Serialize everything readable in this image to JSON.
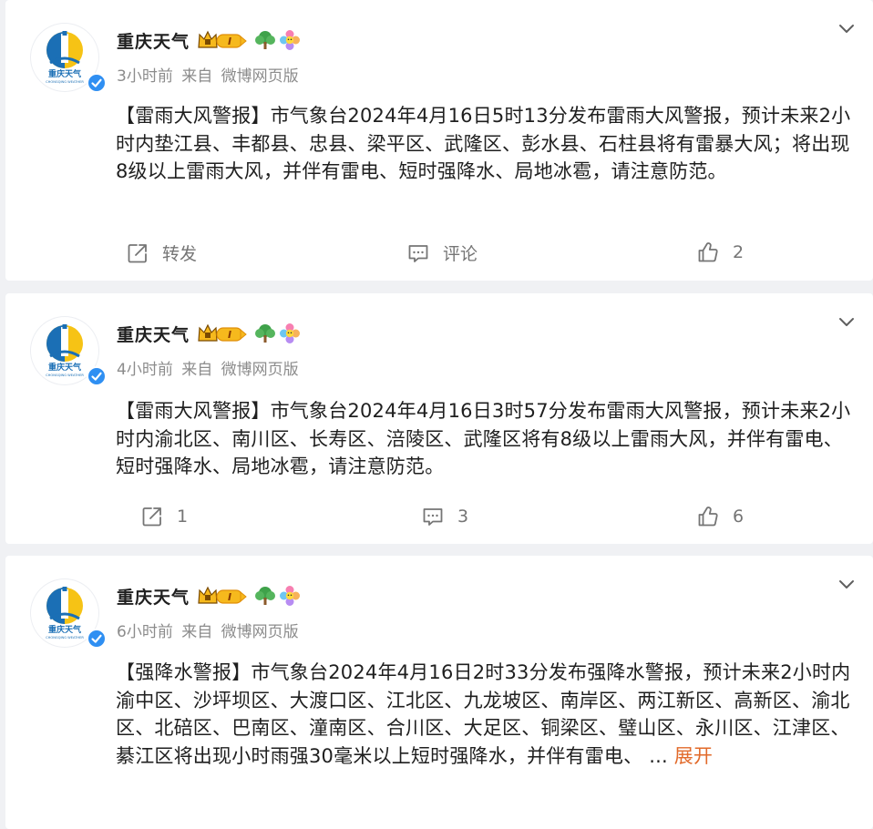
{
  "colors": {
    "page_background": "#f0f1f4",
    "card_background": "#ffffff",
    "text": "#1f1f1f",
    "meta_text": "#8c8c8c",
    "action_text": "#757575",
    "expand_link": "#e26a2a",
    "verified_badge": "#2f8ff2",
    "vip_badge": "#f6b91d"
  },
  "icons": {
    "menu": "chevron-down-icon",
    "repost": "share-icon",
    "comment": "comment-icon",
    "like": "thumbs-up-icon",
    "verified": "verified-check-icon",
    "vip": "crown-vip-badge-icon",
    "tree": "tree-icon",
    "flower": "flower-icon"
  },
  "posts": [
    {
      "author": "重庆天气",
      "vip_level": "I",
      "avatar_caption": "重庆天气",
      "avatar_subcaption": "CHONGQING WEATHER",
      "time": "3小时前",
      "source_prefix": "来自",
      "source": "微博网页版",
      "text": "【雷雨大风警报】市气象台2024年4月16日5时13分发布雷雨大风警报，预计未来2小时内垫江县、丰都县、忠县、梁平区、武隆区、彭水县、石柱县将有雷暴大风；将出现8级以上雷雨大风，并伴有雷电、短时强降水、局地冰雹，请注意防范。",
      "more_ellipsis": "",
      "more_label": "",
      "actions": {
        "repost": "转发",
        "comment": "评论",
        "like": "2"
      }
    },
    {
      "author": "重庆天气",
      "vip_level": "I",
      "avatar_caption": "重庆天气",
      "avatar_subcaption": "CHONGQING WEATHER",
      "time": "4小时前",
      "source_prefix": "来自",
      "source": "微博网页版",
      "text": "【雷雨大风警报】市气象台2024年4月16日3时57分发布雷雨大风警报，预计未来2小时内渝北区、南川区、长寿区、涪陵区、武隆区将有8级以上雷雨大风，并伴有雷电、短时强降水、局地冰雹，请注意防范。",
      "more_ellipsis": "",
      "more_label": "",
      "actions": {
        "repost": "1",
        "comment": "3",
        "like": "6"
      }
    },
    {
      "author": "重庆天气",
      "vip_level": "I",
      "avatar_caption": "重庆天气",
      "avatar_subcaption": "CHONGQING WEATHER",
      "time": "6小时前",
      "source_prefix": "来自",
      "source": "微博网页版",
      "text": "【强降水警报】市气象台2024年4月16日2时33分发布强降水警报，预计未来2小时内渝中区、沙坪坝区、大渡口区、江北区、九龙坡区、南岸区、两江新区、高新区、渝北区、北碚区、巴南区、潼南区、合川区、大足区、铜梁区、璧山区、永川区、江津区、綦江区将出现小时雨强30毫米以上短时强降水，并伴有雷电、",
      "more_ellipsis": " ...",
      "more_label": "展开",
      "actions": null
    }
  ]
}
